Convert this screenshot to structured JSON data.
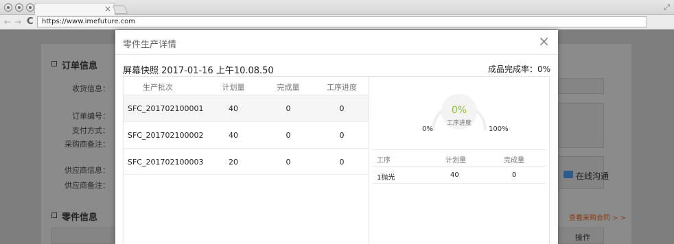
{
  "browser": {
    "url": "https://www.imefuture.com",
    "tab_close": "×",
    "back": "←",
    "forward": "→",
    "reload": "C",
    "expand": "⤢"
  },
  "background_page": {
    "order_section_title": "订单信息",
    "labels": {
      "shipping": "收货信息：",
      "order_no": "订单编号：",
      "payment": "支付方式：",
      "buyer_note": "采购商备注：",
      "supplier_info": "供应商信息：",
      "supplier_note": "供应商备注："
    },
    "parts_section_title": "零件信息",
    "contract_link": "查看采购合同 > >",
    "chat_link": "在线沟通",
    "operation_col": "操作"
  },
  "modal": {
    "title": "零件生产详情",
    "close": "×",
    "snapshot": "屏幕快照 2017-01-16 上午10.08.50",
    "completion_rate": "成品完成率：0%",
    "batch_table": {
      "headers": [
        "生产批次",
        "计划量",
        "完成量",
        "工序进度"
      ],
      "rows": [
        [
          "SFC_201702100001",
          "40",
          "0",
          "0"
        ],
        [
          "SFC_201702100002",
          "40",
          "0",
          "0"
        ],
        [
          "SFC_201702100003",
          "20",
          "0",
          "0"
        ]
      ]
    },
    "gauge": {
      "value": "0%",
      "label": "工序进度",
      "min": "0%",
      "max": "100%",
      "progress": 0,
      "track_color": "#eeeeee",
      "accent_color": "#8cbc2c"
    },
    "process_table": {
      "headers": [
        "工序",
        "计划量",
        "完成量"
      ],
      "rows": [
        [
          "1抛光",
          "40",
          "0"
        ]
      ]
    }
  }
}
